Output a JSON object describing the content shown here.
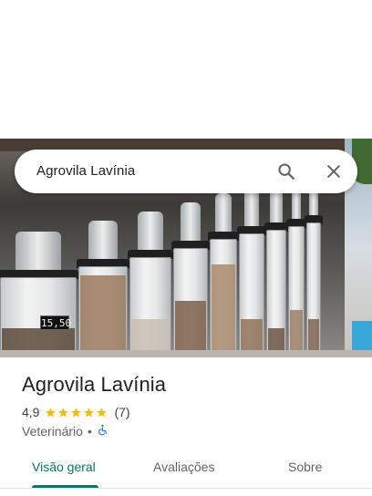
{
  "search": {
    "query": "Agrovila Lavínia"
  },
  "place": {
    "name": "Agrovila Lavínia",
    "rating": "4,9",
    "stars_filled": 5,
    "review_count": "(7)",
    "category": "Veterinário",
    "separator": "•",
    "accessibility_icon": "wheelchair-accessible-icon"
  },
  "photo": {
    "price_display": "15,50"
  },
  "tabs": [
    {
      "label": "Visão geral",
      "active": true
    },
    {
      "label": "Avaliações",
      "active": false
    },
    {
      "label": "Sobre",
      "active": false
    }
  ],
  "colors": {
    "accent": "#00796b",
    "star": "#fbbc04",
    "accessibility_blue": "#1a73e8",
    "text_primary": "#202124",
    "text_secondary": "#5f6368"
  }
}
